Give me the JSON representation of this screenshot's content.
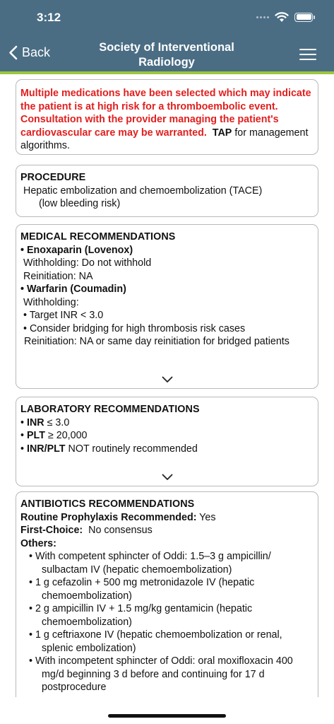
{
  "status_bar": {
    "time": "3:12"
  },
  "header": {
    "back_label": "Back",
    "title_line1": "Society of Interventional",
    "title_line2": "Radiology"
  },
  "alert": {
    "warning_text": "Multiple medications have been selected which may indicate the patient is at high risk for a thromboembolic event.  Consultation with the provider managing the patient's cardiovascular care may be warranted.",
    "tap_text": "TAP",
    "suffix_text": "for management algorithms."
  },
  "procedure": {
    "title": "PROCEDURE",
    "line1": "Hepatic embolization and chemoembolization (TACE)",
    "line2": "(low bleeding risk)"
  },
  "medical": {
    "title": "MEDICAL RECOMMENDATIONS",
    "drug1": "• Enoxaparin (Lovenox)",
    "drug1_withholding": "Withholding: Do not withhold",
    "drug1_reinitiation": "Reinitiation: NA",
    "drug2": "• Warfarin (Coumadin)",
    "drug2_withholding": "Withholding:",
    "drug2_bullet1": "• Target INR < 3.0",
    "drug2_bullet2": "• Consider bridging for high thrombosis risk cases",
    "drug2_reinitiation": "Reinitiation: NA or same day reinitiation for bridged patients"
  },
  "laboratory": {
    "title": "LABORATORY RECOMMENDATIONS",
    "item1_label": "INR",
    "item1_value": "≤ 3.0",
    "item2_label": "PLT",
    "item2_value": "≥ 20,000",
    "item3_label": "INR/PLT",
    "item3_value": "NOT routinely recommended"
  },
  "antibiotics": {
    "title": "ANTIBIOTICS RECOMMENDATIONS",
    "routine_label": "Routine Prophylaxis Recommended:",
    "routine_value": "Yes",
    "first_label": "First-Choice:",
    "first_value": "No consensus",
    "others_label": "Others:",
    "items": [
      "• With competent sphincter of Oddi: 1.5–3 g ampicillin/ sulbactam IV (hepatic chemoembolization)",
      "• 1 g cefazolin + 500 mg metronidazole IV (hepatic chemoembolization)",
      "•  2 g ampicillin IV + 1.5 mg/kg gentamicin (hepatic chemoembolization)",
      "• 1 g ceftriaxone IV (hepatic chemoembolization or renal, splenic embolization)",
      "• With incompetent sphincter of Oddi: oral moxifloxacin 400 mg/d beginning 3 d before and continuing for 17 d postprocedure"
    ]
  },
  "colors": {
    "header_bg": "#4a6d84",
    "accent_line": "#9cc63c",
    "warning_red": "#e0201f"
  },
  "icons": [
    "back-chevron-icon",
    "menu-icon",
    "wifi-icon",
    "battery-icon",
    "chevron-down-icon"
  ]
}
